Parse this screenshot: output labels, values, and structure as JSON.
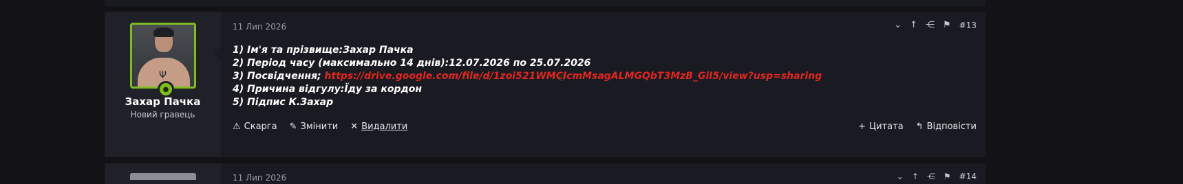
{
  "post": {
    "date": "11 Лип 2026",
    "number": "#13",
    "author": {
      "name": "Захар Пачка",
      "title": "Новий гравець"
    },
    "message_lines": [
      "1) Ім'я та прізвище:Захар Пачка",
      "2) Період часу (максимально 14 днів):12.07.2026 по 25.07.2026",
      "3) Посвідчення; ",
      "4) Причина відгулу:Їду за кордон",
      "5) Підпис К.Захар"
    ],
    "link_text": "https://drive.google.com/file/d/1zoi521WMCIcmMsagALMGQbT3MzB_GiI5/view?usp=sharing",
    "footer": {
      "report": "Скарга",
      "edit": "Змінити",
      "delete": "Видалити",
      "quote": "Цитата",
      "reply": "Відповісти"
    }
  },
  "next_post": {
    "date": "11 Лип 2026",
    "number": "#14"
  },
  "colors": {
    "accent_green": "#7dbd1e",
    "link_red": "#e0271f",
    "background": "#121217"
  }
}
